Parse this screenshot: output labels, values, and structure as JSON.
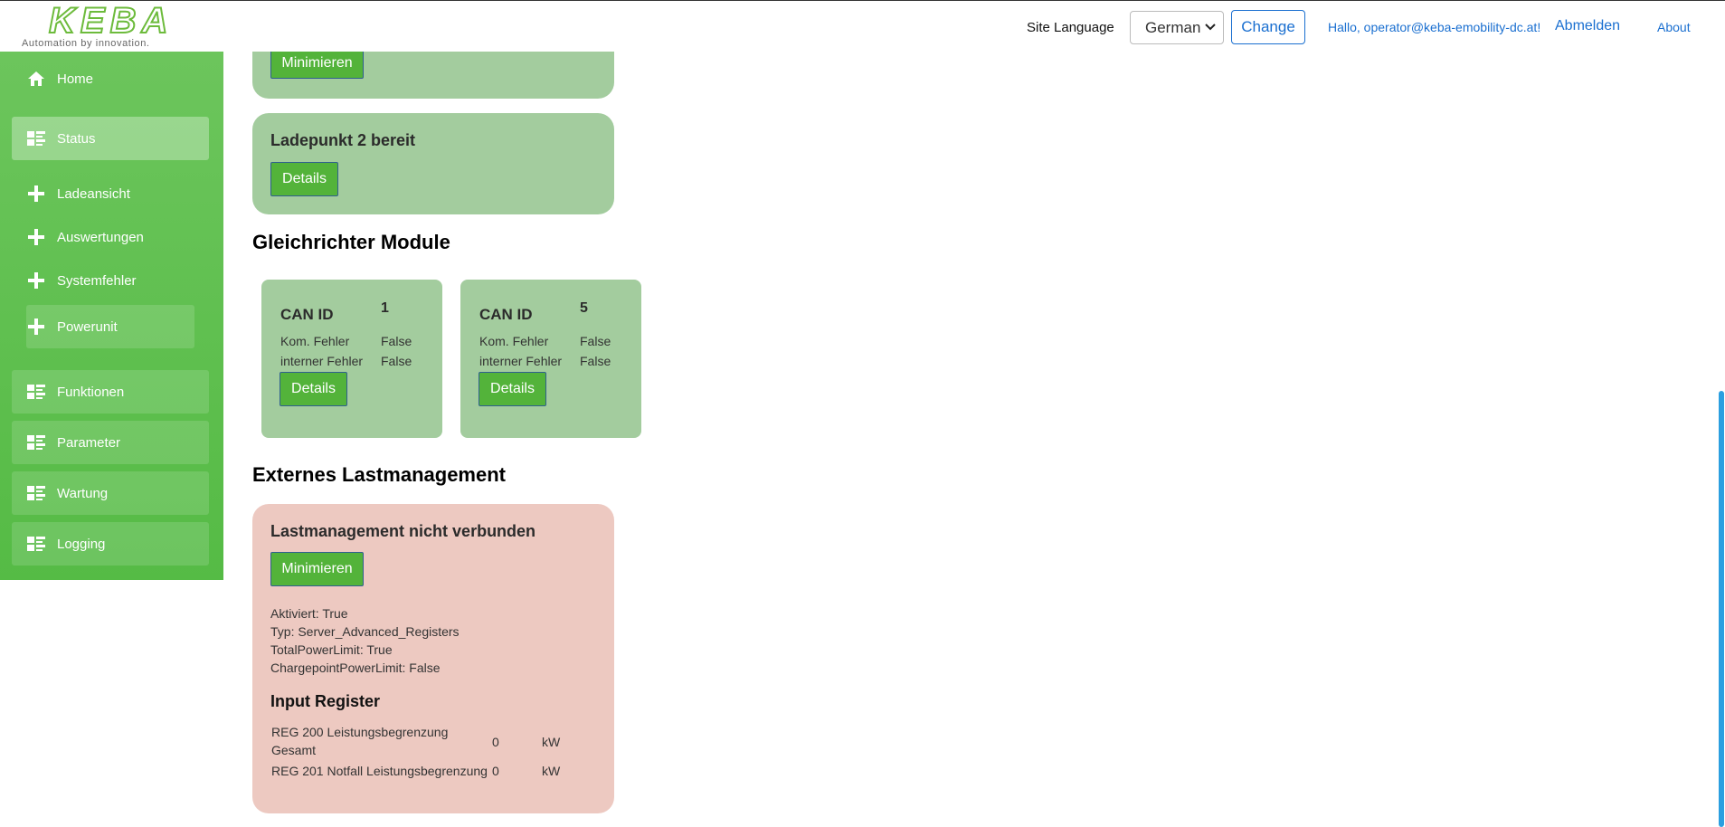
{
  "header": {
    "logo_text": "KEBA",
    "logo_tagline": "Automation by innovation.",
    "site_language_label": "Site Language",
    "language_selected": "German",
    "change_label": "Change",
    "greeting": "Hallo, operator@keba-emobility-dc.at!",
    "logout_label": "Abmelden",
    "about_label": "About"
  },
  "sidebar": {
    "items": [
      {
        "label": "Home",
        "icon": "home-icon"
      },
      {
        "label": "Status",
        "icon": "dashboard-icon"
      },
      {
        "label": "Ladeansicht",
        "icon": "plus-icon"
      },
      {
        "label": "Auswertungen",
        "icon": "plus-icon"
      },
      {
        "label": "Systemfehler",
        "icon": "plus-icon"
      },
      {
        "label": "Powerunit",
        "icon": "plus-icon"
      },
      {
        "label": "Funktionen",
        "icon": "dashboard-icon"
      },
      {
        "label": "Parameter",
        "icon": "dashboard-icon"
      },
      {
        "label": "Wartung",
        "icon": "dashboard-icon"
      },
      {
        "label": "Logging",
        "icon": "dashboard-icon"
      }
    ]
  },
  "content": {
    "top_card": {
      "button_label": "Minimieren"
    },
    "ladepunkt2": {
      "title": "Ladepunkt 2 bereit",
      "button_label": "Details"
    },
    "rectifier": {
      "title": "Gleichrichter Module",
      "modules": [
        {
          "can_id_label": "CAN ID",
          "can_id": "1",
          "kom_label": "Kom. Fehler",
          "kom_value": "False",
          "int_label": "interner Fehler",
          "int_value": "False",
          "button_label": "Details"
        },
        {
          "can_id_label": "CAN ID",
          "can_id": "5",
          "kom_label": "Kom. Fehler",
          "kom_value": "False",
          "int_label": "interner Fehler",
          "int_value": "False",
          "button_label": "Details"
        }
      ]
    },
    "external_lm": {
      "title": "Externes Lastmanagement",
      "card_title": "Lastmanagement nicht verbunden",
      "button_label": "Minimieren",
      "lines": [
        "Aktiviert: True",
        "Typ: Server_Advanced_Registers",
        "TotalPowerLimit: True",
        "ChargepointPowerLimit: False"
      ],
      "input_register_title": "Input Register",
      "registers": [
        {
          "name": "REG 200 Leistungsbegrenzung Gesamt",
          "value": "0",
          "unit": "kW"
        },
        {
          "name": "REG 201 Notfall Leistungsbegrenzung",
          "value": "0",
          "unit": "kW"
        }
      ]
    }
  },
  "colors": {
    "sidebar_green": "#5cbf4c",
    "card_green": "#a3cc9e",
    "card_red": "#edc9c1",
    "button_green": "#53b33a",
    "link_blue": "#1a6fd0"
  }
}
